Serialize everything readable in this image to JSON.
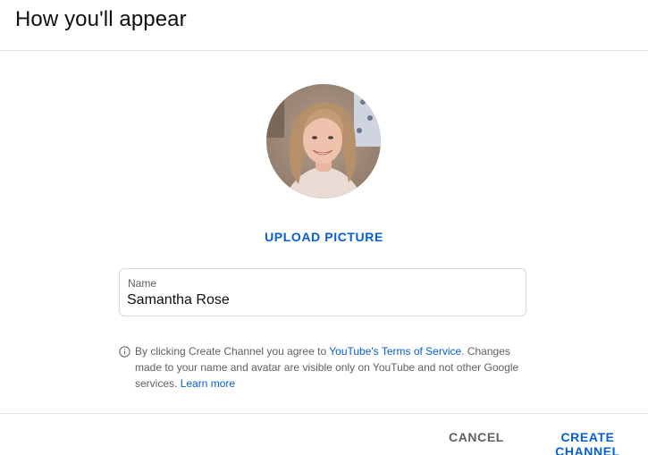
{
  "dialog": {
    "title": "How you'll appear"
  },
  "avatar": {
    "alt": "Profile picture"
  },
  "upload": {
    "label": "UPLOAD PICTURE"
  },
  "name_field": {
    "label": "Name",
    "value": "Samantha Rose"
  },
  "notice": {
    "prefix": "By clicking Create Channel you agree to ",
    "tos_link": "YouTube's Terms of Service",
    "suffix": ". Changes made to your name and avatar are visible only on YouTube and not other Google services. ",
    "learn_more": "Learn more",
    "icon": "info-icon"
  },
  "actions": {
    "cancel_label": "CANCEL",
    "create_label": "CREATE CHANNEL"
  },
  "colors": {
    "accent": "#065fd4",
    "secondary_text": "#606060",
    "border": "#d9d9d9"
  }
}
